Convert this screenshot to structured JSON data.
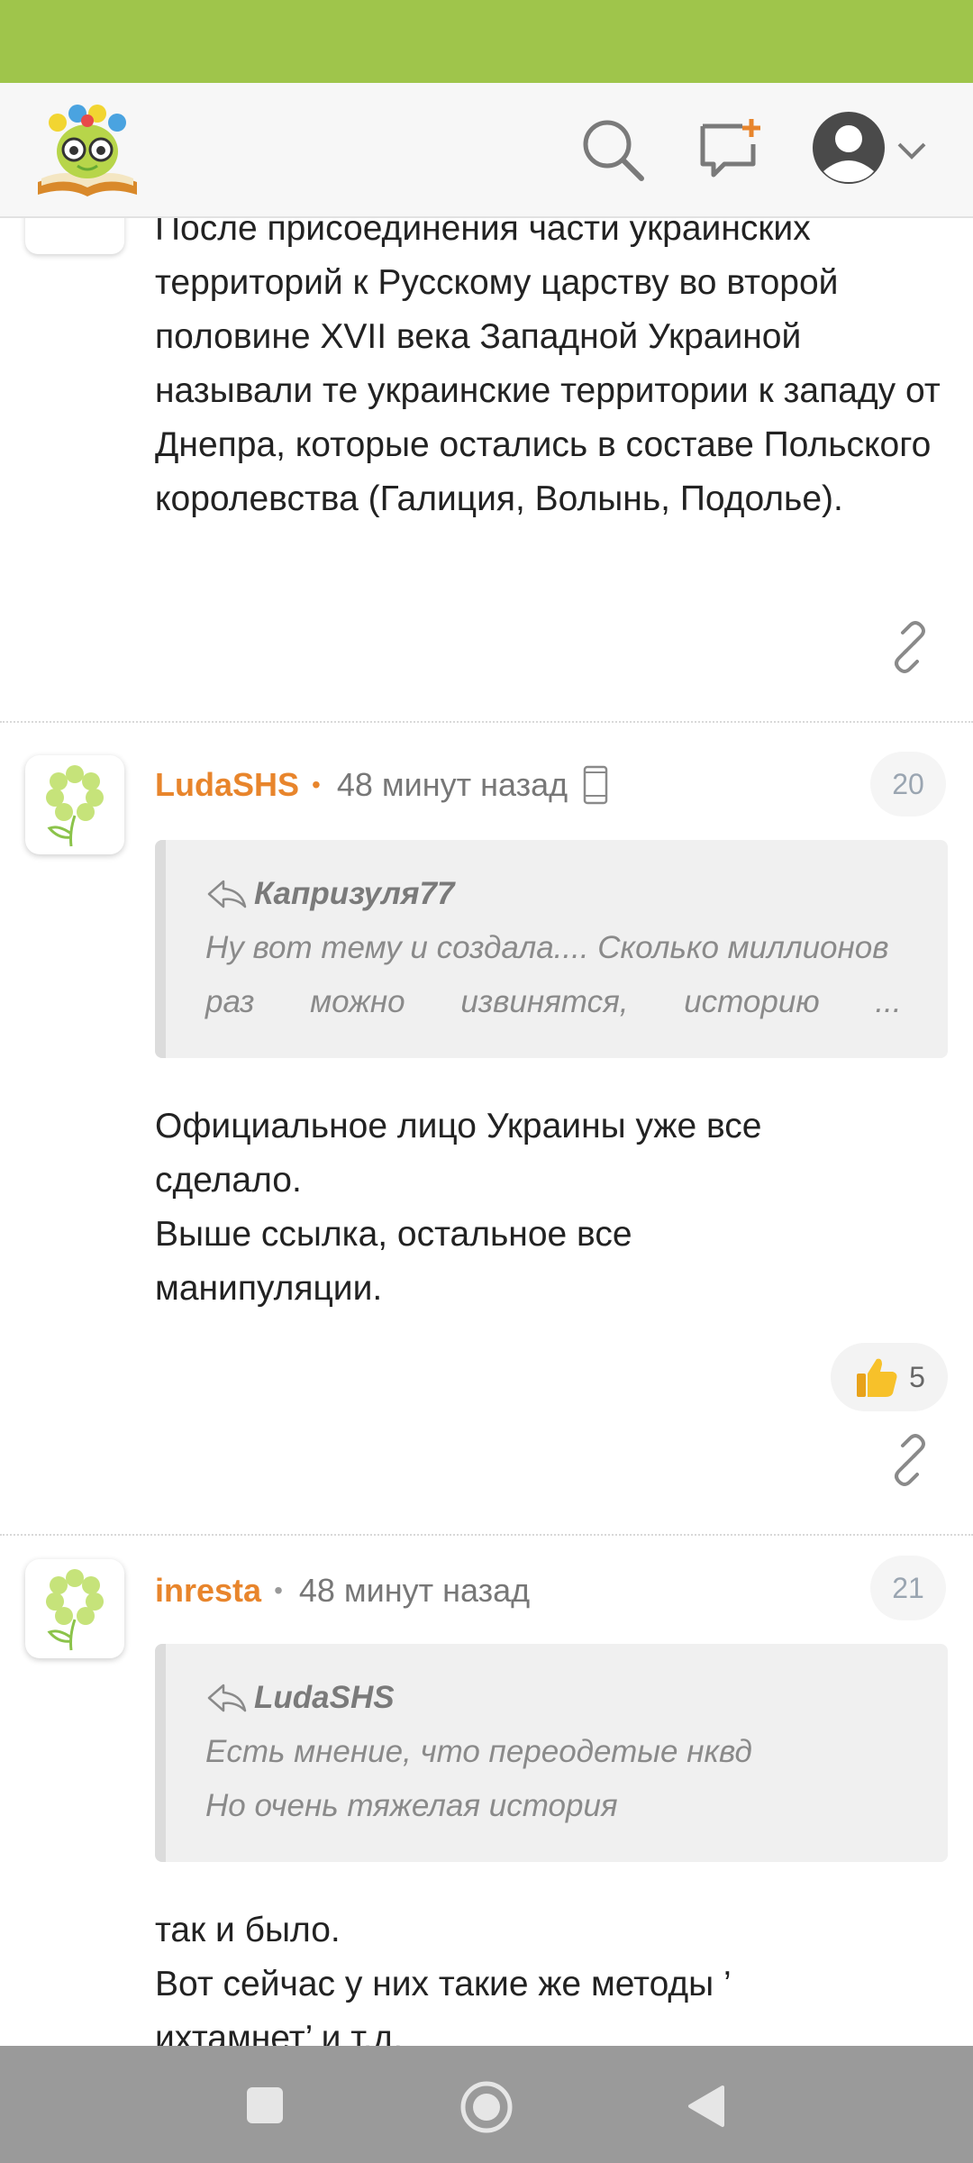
{
  "post_partial": {
    "paragraph": "После присоединения части украинских территорий к Русскому царству во второй половине XVII века Западной Украиной называли те украинские территории к западу от Днепра, которые остались в составе Польского королевства (Галиция, Волынь, Подолье)."
  },
  "comments": [
    {
      "author": "LudaSHS",
      "time": "48 минут назад",
      "number": "20",
      "quote_author": "Капризуля77",
      "quote_lines": [
        "Ну вот тему и создала.... Сколько миллионов",
        "раз можно извинятся, историю ..."
      ],
      "body": [
        "Официальное лицо Украины уже все",
        "сделало.",
        "Выше ссылка, остальное все",
        "манипуляции."
      ],
      "likes": "5",
      "device": "mobile-device-icon"
    },
    {
      "author": "inresta",
      "time": "48 минут назад",
      "number": "21",
      "quote_author": "LudaSHS",
      "quote_lines": [
        "Есть мнение, что переодетые нквд",
        "Но очень тяжелая история"
      ],
      "body": [
        "так и было.",
        "Вот сейчас у них такие же методы ’",
        "ихтамнет’ и т.д."
      ]
    }
  ],
  "colors": {
    "status_bar": "#9fc54b",
    "author": "#e8852c",
    "nav_bar": "#9a9a9a"
  },
  "icons": {
    "search": "search-icon",
    "new_post": "new-post-icon",
    "profile": "profile-icon",
    "link": "link-icon",
    "reply": "reply-arrow-icon",
    "like": "thumbs-up-icon"
  }
}
